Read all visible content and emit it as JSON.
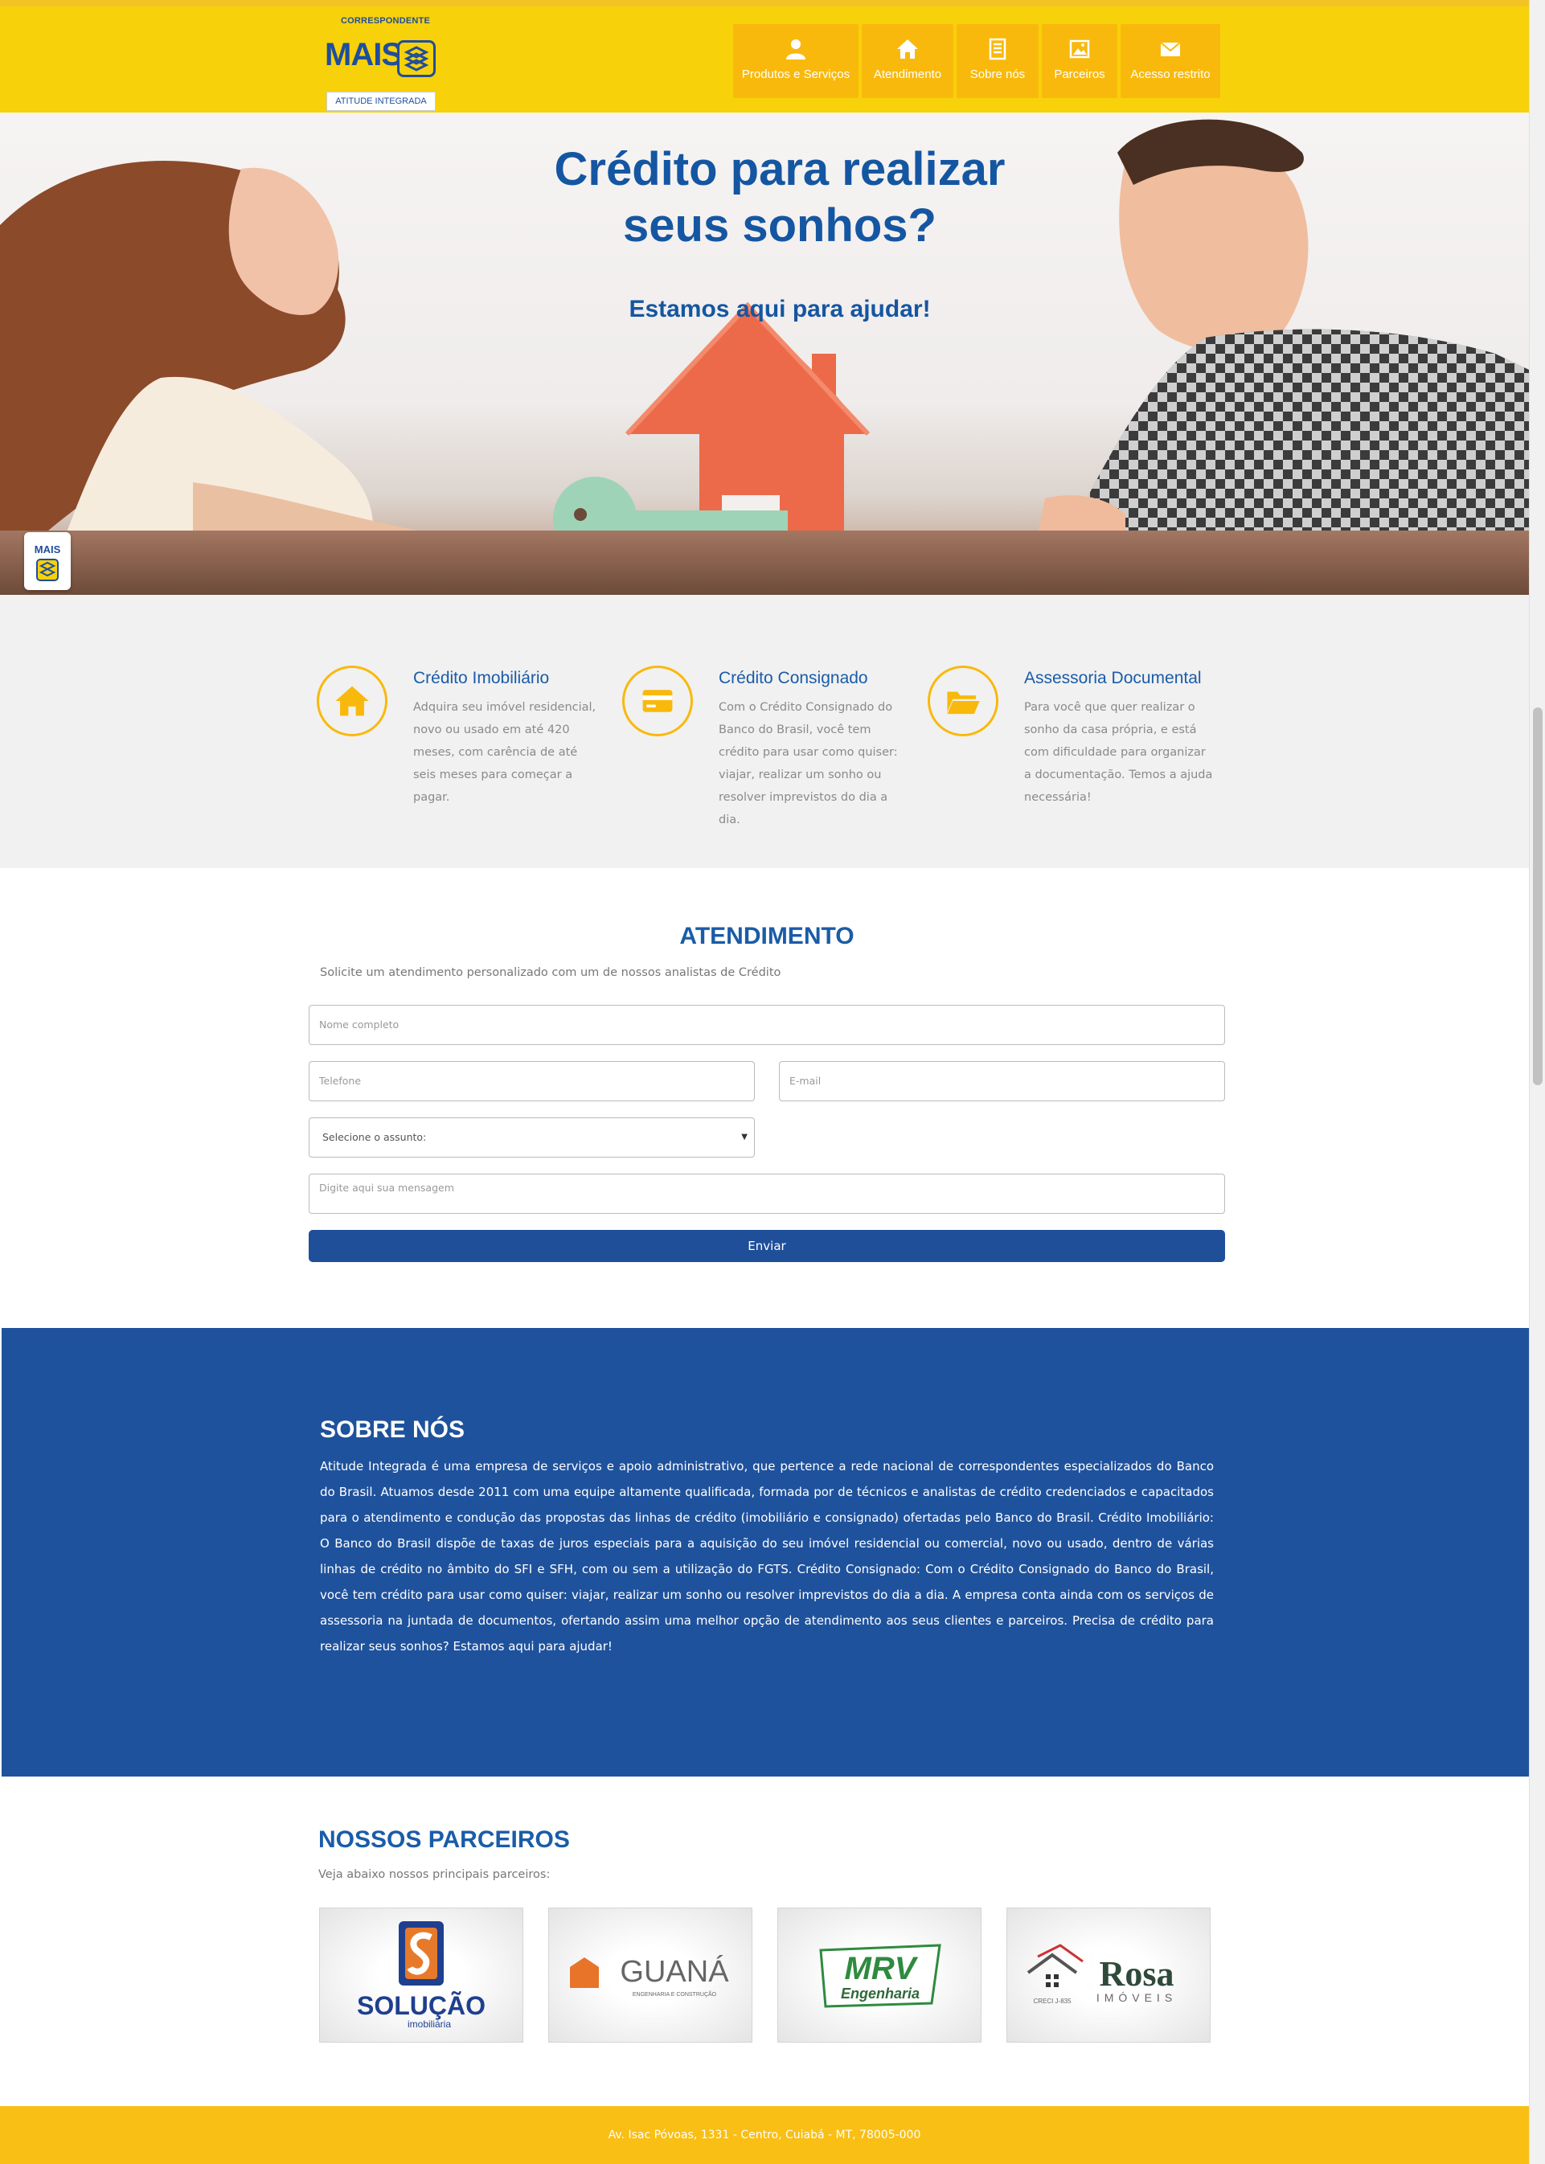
{
  "header": {
    "logo_top": "CORRESPONDENTE",
    "logo_main": "MAIS",
    "logo_tag": "ATITUDE INTEGRADA",
    "nav": [
      {
        "label": "Produtos e Serviços",
        "icon": "user-icon"
      },
      {
        "label": "Atendimento",
        "icon": "home-icon"
      },
      {
        "label": "Sobre nós",
        "icon": "document-icon"
      },
      {
        "label": "Parceiros",
        "icon": "image-icon"
      },
      {
        "label": "Acesso restrito",
        "icon": "envelope-icon"
      }
    ]
  },
  "hero": {
    "title_line1": "Crédito para realizar",
    "title_line2": "seus sonhos?",
    "subtitle": "Estamos aqui para ajudar!",
    "badge_text": "MAIS"
  },
  "features": [
    {
      "title": "Crédito Imobiliário",
      "text": "Adquira seu imóvel residencial, novo ou usado em até 420 meses, com carência de até seis meses para começar a pagar.",
      "icon": "home-icon"
    },
    {
      "title": "Crédito Consignado",
      "text": "Com o Crédito Consignado do Banco do Brasil, você tem crédito para usar como quiser: viajar, realizar um sonho ou resolver imprevistos do dia a dia.",
      "icon": "card-icon"
    },
    {
      "title": "Assessoria Documental",
      "text": "Para você que quer realizar o sonho da casa própria, e está com dificuldade para organizar a documentação. Temos a ajuda necessária!",
      "icon": "folder-icon"
    }
  ],
  "atendimento": {
    "title": "ATENDIMENTO",
    "subtitle": "Solicite um atendimento personalizado com um de nossos analistas de Crédito",
    "name_placeholder": "Nome completo",
    "phone_placeholder": "Telefone",
    "email_placeholder": "E-mail",
    "subject_selected": "Selecione o assunto:",
    "message_placeholder": "Digite aqui sua mensagem",
    "send_label": "Enviar"
  },
  "sobre": {
    "title": "SOBRE NÓS",
    "text": "Atitude Integrada é uma empresa de serviços e apoio administrativo, que pertence a rede nacional de correspondentes especializados do Banco do Brasil. Atuamos desde 2011 com uma equipe altamente qualificada, formada por de técnicos e analistas de crédito credenciados e capacitados para o atendimento e condução das propostas das linhas de crédito (imobiliário e consignado) ofertadas pelo Banco do Brasil. Crédito Imobiliário: O Banco do Brasil dispõe de taxas de juros especiais para a aquisição do seu imóvel residencial ou comercial, novo ou usado, dentro de várias linhas de crédito no âmbito do SFI e SFH, com ou sem a utilização do FGTS. Crédito Consignado: Com o Crédito Consignado do Banco do Brasil, você tem crédito para usar como quiser: viajar, realizar um sonho ou resolver imprevistos do dia a dia. A empresa conta ainda com os serviços de assessoria na juntada de documentos, ofertando assim uma melhor opção de atendimento aos seus clientes e parceiros. Precisa de crédito para realizar seus sonhos? Estamos aqui para ajudar!"
  },
  "parceiros": {
    "title": "NOSSOS PARCEIROS",
    "subtitle": "Veja abaixo nossos principais parceiros:",
    "logos": [
      {
        "name": "SOLUÇÃO",
        "sub": "imobiliária"
      },
      {
        "name": "GUANÁ",
        "sub": "ENGENHARIA E CONSTRUÇÃO"
      },
      {
        "name": "MRV",
        "sub": "Engenharia"
      },
      {
        "name": "Rosa",
        "sub": "IMÓVEIS",
        "creci": "CRECI J-835"
      }
    ]
  },
  "footer": {
    "address": "Av. Isac Póvoas, 1331 - Centro, Cuiabá - MT, 78005-000"
  },
  "colors": {
    "header_yellow": "#f7d10a",
    "nav_orange": "#f9b90c",
    "brand_blue": "#1a5ca8",
    "section_blue": "#1f529c",
    "footer_yellow": "#f9bf15"
  }
}
